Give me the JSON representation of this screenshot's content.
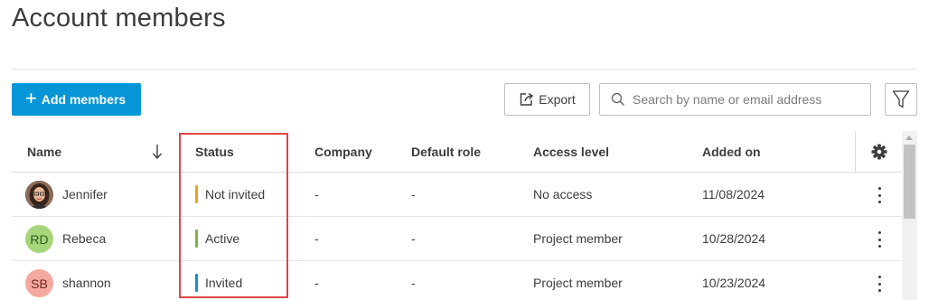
{
  "page": {
    "title": "Account members"
  },
  "toolbar": {
    "add_label": "Add members",
    "export_label": "Export",
    "search_placeholder": "Search by name or email address"
  },
  "table": {
    "columns": [
      "Name",
      "Status",
      "Company",
      "Default role",
      "Access level",
      "Added on"
    ],
    "rows": [
      {
        "name": "Jennifer",
        "initials": "",
        "avatar_type": "photo",
        "status": "Not invited",
        "status_color": "#f0a11a",
        "company": "-",
        "default_role": "-",
        "access_level": "No access",
        "added_on": "11/08/2024"
      },
      {
        "name": "Rebeca",
        "initials": "RD",
        "avatar_type": "initials",
        "avatar_color": "#a7d67a",
        "status": "Active",
        "status_color": "#7ab648",
        "company": "-",
        "default_role": "-",
        "access_level": "Project member",
        "added_on": "10/28/2024"
      },
      {
        "name": "shannon",
        "initials": "SB",
        "avatar_type": "initials",
        "avatar_color": "#f5a8a0",
        "status": "Invited",
        "status_color": "#1a8ec9",
        "company": "-",
        "default_role": "-",
        "access_level": "Project member",
        "added_on": "10/23/2024"
      }
    ]
  },
  "icons": {
    "add": "plus-icon",
    "export": "export-icon",
    "search": "search-icon",
    "filter": "filter-icon",
    "sort": "arrow-down-icon",
    "settings": "gear-icon",
    "row_menu": "kebab-icon"
  },
  "colors": {
    "primary": "#0696d7",
    "highlight": "#e04646"
  }
}
